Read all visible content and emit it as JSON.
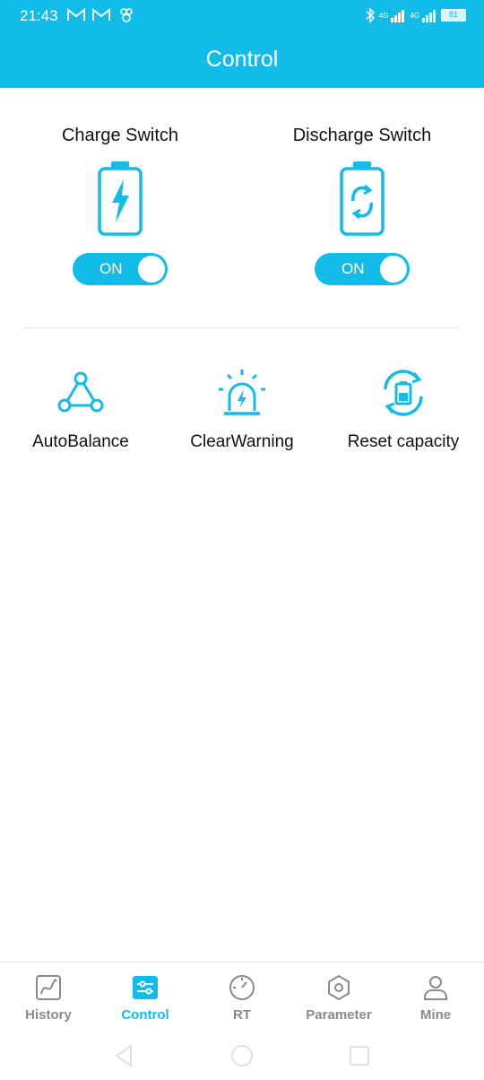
{
  "status_bar": {
    "time": "21:43",
    "left_icons": [
      "gmail-icon",
      "gmail-icon",
      "app-notification-icon"
    ],
    "right_icons": [
      "bluetooth-icon",
      "signal-4g-icon",
      "signal-4g-icon",
      "battery-icon"
    ],
    "network_1": "4G",
    "network_2": "4G",
    "battery_level": "81"
  },
  "header": {
    "title": "Control",
    "background_color": "#12BCE8"
  },
  "switches": [
    {
      "label": "Charge Switch",
      "icon": "battery-charge-icon",
      "state_label": "ON",
      "on": true
    },
    {
      "label": "Discharge Switch",
      "icon": "battery-discharge-icon",
      "state_label": "ON",
      "on": true
    }
  ],
  "actions": [
    {
      "label": "AutoBalance",
      "icon": "balance-triangle-icon"
    },
    {
      "label": "ClearWarning",
      "icon": "alarm-light-icon"
    },
    {
      "label": "Reset capacity",
      "icon": "reset-battery-icon"
    }
  ],
  "bottom_nav": {
    "active": "Control",
    "items": [
      {
        "label": "History",
        "icon": "chart-line-icon"
      },
      {
        "label": "Control",
        "icon": "sliders-icon"
      },
      {
        "label": "RT",
        "icon": "gauge-icon"
      },
      {
        "label": "Parameter",
        "icon": "hexagon-settings-icon"
      },
      {
        "label": "Mine",
        "icon": "user-icon"
      }
    ]
  },
  "system_nav": [
    "back-icon",
    "home-icon",
    "recent-apps-icon"
  ],
  "colors": {
    "accent": "#12BCE8",
    "inactive": "#8a8a8a",
    "text": "#111111"
  }
}
